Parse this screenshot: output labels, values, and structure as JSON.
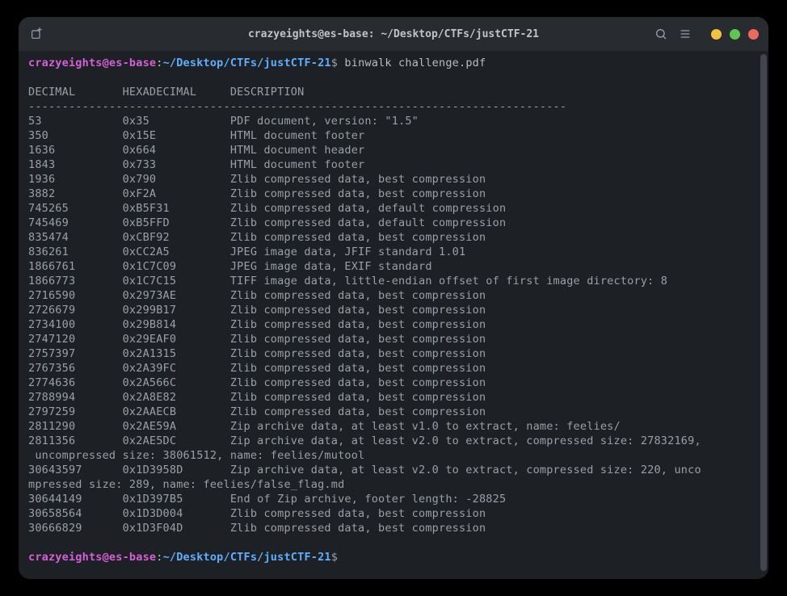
{
  "titlebar": {
    "title": "crazyeights@es-base: ~/Desktop/CTFs/justCTF-21"
  },
  "prompt": {
    "user": "crazyeights@es-base",
    "colon": ":",
    "path": "~/Desktop/CTFs/justCTF-21",
    "dollar": "$"
  },
  "command": " binwalk challenge.pdf",
  "headers": "DECIMAL       HEXADECIMAL     DESCRIPTION",
  "separator": "--------------------------------------------------------------------------------",
  "rows": [
    "53            0x35            PDF document, version: \"1.5\"",
    "350           0x15E           HTML document footer",
    "1636          0x664           HTML document header",
    "1843          0x733           HTML document footer",
    "1936          0x790           Zlib compressed data, best compression",
    "3882          0xF2A           Zlib compressed data, best compression",
    "745265        0xB5F31         Zlib compressed data, default compression",
    "745469        0xB5FFD         Zlib compressed data, default compression",
    "835474        0xCBF92         Zlib compressed data, best compression",
    "836261        0xCC2A5         JPEG image data, JFIF standard 1.01",
    "1866761       0x1C7C09        JPEG image data, EXIF standard",
    "1866773       0x1C7C15        TIFF image data, little-endian offset of first image directory: 8",
    "2716590       0x2973AE        Zlib compressed data, best compression",
    "2726679       0x299B17        Zlib compressed data, best compression",
    "2734100       0x29B814        Zlib compressed data, best compression",
    "2747120       0x29EAF0        Zlib compressed data, best compression",
    "2757397       0x2A1315        Zlib compressed data, best compression",
    "2767356       0x2A39FC        Zlib compressed data, best compression",
    "2774636       0x2A566C        Zlib compressed data, best compression",
    "2788994       0x2A8E82        Zlib compressed data, best compression",
    "2797259       0x2AAECB        Zlib compressed data, best compression",
    "2811290       0x2AE59A        Zip archive data, at least v1.0 to extract, name: feelies/",
    "2811356       0x2AE5DC        Zip archive data, at least v2.0 to extract, compressed size: 27832169,\n uncompressed size: 38061512, name: feelies/mutool",
    "30643597      0x1D3958D       Zip archive data, at least v2.0 to extract, compressed size: 220, unco\nmpressed size: 289, name: feelies/false_flag.md",
    "30644149      0x1D397B5       End of Zip archive, footer length: -28825",
    "30658564      0x1D3D004       Zlib compressed data, best compression",
    "30666829      0x1D3F04D       Zlib compressed data, best compression"
  ]
}
